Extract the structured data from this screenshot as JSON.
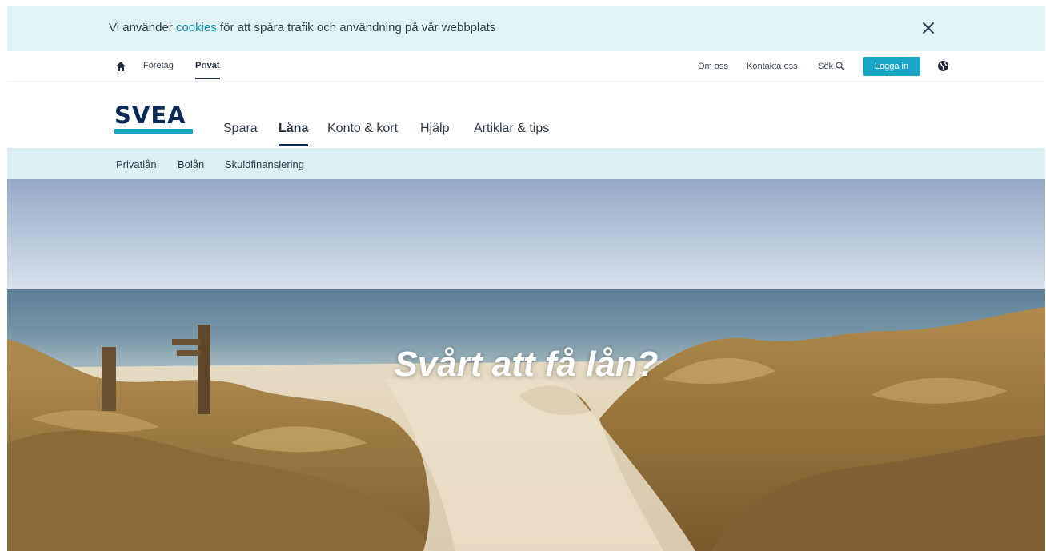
{
  "cookie_banner": {
    "text_before": "Vi använder ",
    "link_text": "cookies",
    "text_after": " för att spåra trafik och användning på vår webbplats",
    "close_label": "×"
  },
  "util_bar": {
    "segments": [
      "Företag",
      "Privat"
    ],
    "active_segment": "Privat",
    "links": [
      "Om oss",
      "Kontakta oss",
      "Sök"
    ],
    "login_label": "Logga in"
  },
  "main_nav": {
    "logo_text": "SVEA",
    "items": [
      "Spara",
      "Låna",
      "Konto & kort",
      "Hjälp",
      "Artiklar & tips"
    ],
    "active_item": "Låna"
  },
  "sub_nav": {
    "items": [
      "Privatlån",
      "Bolån",
      "Skuldfinansiering"
    ]
  },
  "hero": {
    "title": "Svårt att få lån?"
  },
  "colors": {
    "accent": "#19a6c6",
    "brand_navy": "#0b2b57",
    "cookie_bg": "#e2f3f6",
    "subnav_bg": "#dcf0f4"
  },
  "icons": [
    "close-icon",
    "home-icon",
    "search-icon",
    "globe-icon"
  ]
}
